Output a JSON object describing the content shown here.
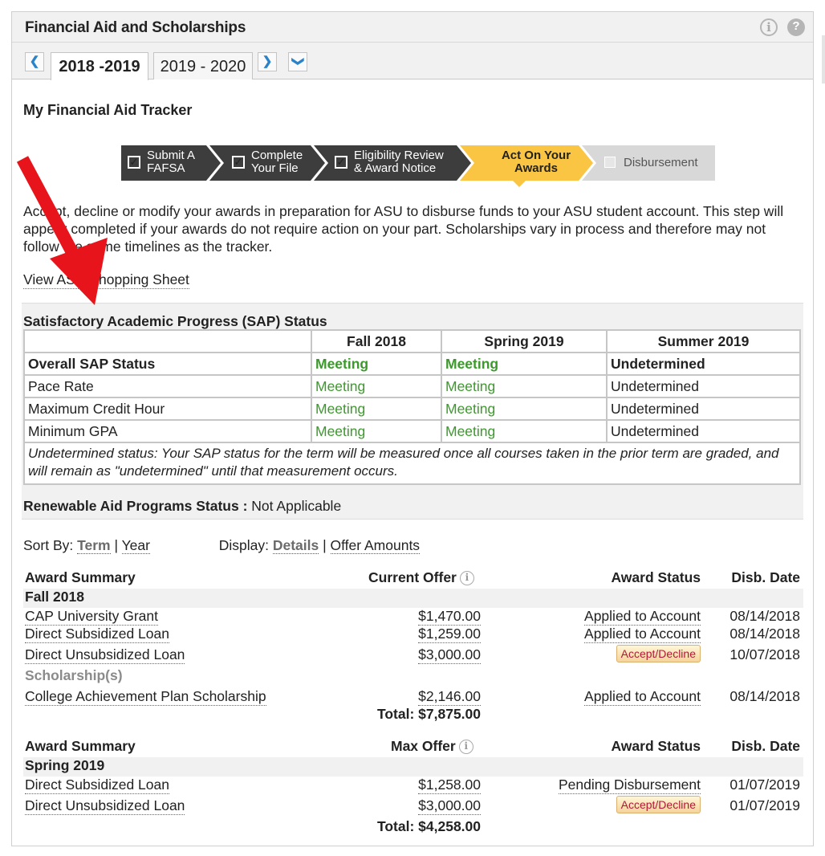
{
  "panel": {
    "title": "Financial Aid and Scholarships"
  },
  "tabs": [
    "2018 -2019",
    "2019 - 2020"
  ],
  "tracker": {
    "title": "My Financial Aid Tracker",
    "steps": [
      {
        "line1": "Submit A",
        "line2": "FAFSA"
      },
      {
        "line1": "Complete",
        "line2": "Your File"
      },
      {
        "line1": "Eligibility Review",
        "line2": "& Award Notice"
      },
      {
        "line1": "Act On Your",
        "line2": "Awards"
      },
      {
        "line1": "Disbursement"
      }
    ]
  },
  "description": "Accept, decline or modify your awards in preparation for ASU to disburse funds to your ASU student account. This step will appear completed if your awards do not require action on your part. Scholarships vary in process and therefore may not follow the same timelines as the tracker.",
  "view_link": "View ASU Shopping Sheet",
  "sap": {
    "heading": "Satisfactory Academic Progress (SAP) Status",
    "columns": [
      "Fall 2018",
      "Spring 2019",
      "Summer 2019"
    ],
    "rows": [
      {
        "label": "Overall SAP Status",
        "fall": "Meeting",
        "spring": "Meeting",
        "summer": "Undetermined"
      },
      {
        "label": "Pace Rate",
        "fall": "Meeting",
        "spring": "Meeting",
        "summer": "Undetermined"
      },
      {
        "label": "Maximum Credit Hour",
        "fall": "Meeting",
        "spring": "Meeting",
        "summer": "Undetermined"
      },
      {
        "label": "Minimum GPA",
        "fall": "Meeting",
        "spring": "Meeting",
        "summer": "Undetermined"
      }
    ],
    "note": "Undetermined status: Your SAP status for the term will be measured once all courses taken in the prior term are graded, and will remain as \"undetermined\" until that measurement occurs."
  },
  "renewable": {
    "label": "Renewable Aid Programs Status :",
    "value": "Not Applicable"
  },
  "sort": {
    "label": "Sort By:",
    "term": "Term",
    "sep": "|",
    "year": "Year"
  },
  "display": {
    "label": "Display:",
    "details": "Details",
    "sep": "|",
    "offer": "Offer Amounts"
  },
  "fall": {
    "hdr_summary": "Award Summary",
    "hdr_offer": "Current Offer",
    "hdr_status": "Award Status",
    "hdr_date": "Disb. Date",
    "term": "Fall 2018",
    "awards": [
      {
        "name": "CAP University Grant",
        "amount": "$1,470.00",
        "status": "Applied to Account",
        "date": "08/14/2018"
      },
      {
        "name": "Direct Subsidized Loan",
        "amount": "$1,259.00",
        "status": "Applied to Account",
        "date": "08/14/2018"
      },
      {
        "name": "Direct Unsubsidized Loan",
        "amount": "$3,000.00",
        "status": "Accept/Decline",
        "date": "10/07/2018"
      }
    ],
    "scholarship_label": "Scholarship(s)",
    "scholarship": {
      "name": "College Achievement Plan Scholarship",
      "amount": "$2,146.00",
      "status": "Applied to Account",
      "date": "08/14/2018"
    },
    "total": "Total: $7,875.00"
  },
  "spring": {
    "hdr_summary": "Award Summary",
    "hdr_offer": "Max Offer",
    "hdr_status": "Award Status",
    "hdr_date": "Disb. Date",
    "term": "Spring 2019",
    "awards": [
      {
        "name": "Direct Subsidized Loan",
        "amount": "$1,258.00",
        "status": "Pending Disbursement",
        "date": "01/07/2019"
      },
      {
        "name": "Direct Unsubsidized Loan",
        "amount": "$3,000.00",
        "status": "Accept/Decline",
        "date": "01/07/2019"
      }
    ],
    "total": "Total: $4,258.00"
  },
  "colors": {
    "meeting": "#3a9a2a",
    "active_step": "#f9c542",
    "step_dark": "#3d3d3d",
    "arrow": "#e8141b"
  }
}
